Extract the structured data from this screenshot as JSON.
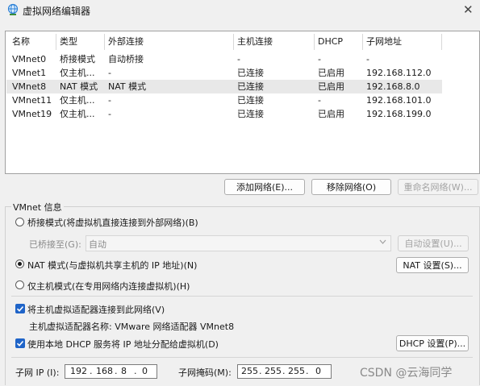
{
  "window": {
    "title": "虚拟网络编辑器",
    "close_glyph": "✕"
  },
  "list": {
    "columns": [
      "名称",
      "类型",
      "外部连接",
      "主机连接",
      "DHCP",
      "子网地址"
    ],
    "rows": [
      [
        "VMnet0",
        "桥接模式",
        "自动桥接",
        "-",
        "-",
        "-"
      ],
      [
        "VMnet1",
        "仅主机...",
        "-",
        "已连接",
        "已启用",
        "192.168.112.0"
      ],
      [
        "VMnet8",
        "NAT 模式",
        "NAT 模式",
        "已连接",
        "已启用",
        "192.168.8.0"
      ],
      [
        "VMnet11",
        "仅主机...",
        "-",
        "已连接",
        "-",
        "192.168.101.0"
      ],
      [
        "VMnet19",
        "仅主机...",
        "-",
        "已连接",
        "已启用",
        "192.168.199.0"
      ]
    ],
    "selected_row": 2
  },
  "buttons": {
    "add_network": "添加网络(E)...",
    "remove_network": "移除网络(O)",
    "rename_network": "重命名网络(W)..."
  },
  "vmnet_info": {
    "label": "VMnet 信息",
    "bridged_label": "桥接模式(将虚拟机直接连接到外部网络)(B)",
    "bridged_to_label": "已桥接至(G):",
    "bridged_to_value": "自动",
    "auto_settings": "自动设置(U)...",
    "nat_label": "NAT 模式(与虚拟机共享主机的 IP 地址)(N)",
    "nat_settings": "NAT 设置(S)...",
    "host_only_label": "仅主机模式(在专用网络内连接虚拟机)(H)",
    "selected_mode": "nat",
    "connect_adapter_label": "将主机虚拟适配器连接到此网络(V)",
    "connect_adapter_checked": true,
    "adapter_name_label": "主机虚拟适配器名称: VMware 网络适配器 VMnet8",
    "dhcp_label": "使用本地 DHCP 服务将 IP 地址分配给虚拟机(D)",
    "dhcp_checked": true,
    "dhcp_settings": "DHCP 设置(P)...",
    "subnet_ip_label": "子网 IP (I):",
    "subnet_ip": [
      "192",
      "168",
      "8",
      "0"
    ],
    "subnet_mask_label": "子网掩码(M):",
    "subnet_mask": [
      "255",
      "255",
      "255",
      "0"
    ]
  },
  "watermark": "CSDN @云海同学",
  "icons": {
    "app": "network-globe-icon",
    "close": "close-icon",
    "dropdown": "chevron-down-icon",
    "check": "checkmark-icon"
  },
  "colors": {
    "accent": "#1f64c8",
    "selected_row": "#e8e8e8",
    "background": "#f0f0f0"
  }
}
